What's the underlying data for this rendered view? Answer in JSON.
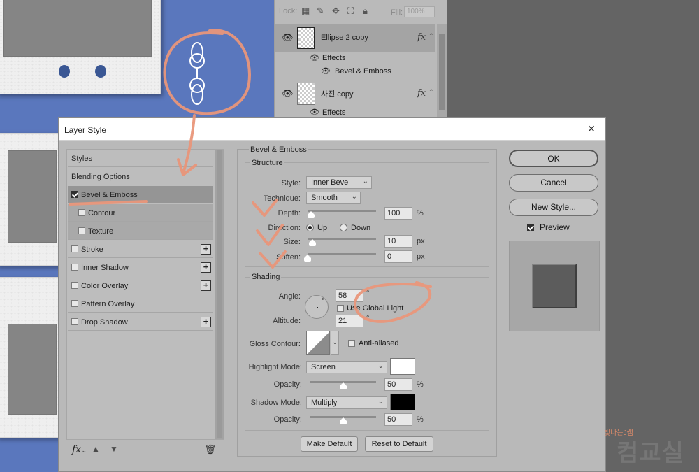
{
  "layers_panel": {
    "lock_label": "Lock:",
    "fill_label": "Fill:",
    "fill_value": "100%",
    "layers": [
      {
        "name": "Ellipse 2 copy",
        "effects_label": "Effects",
        "effect": "Bevel & Emboss"
      },
      {
        "name": "사진 copy",
        "effects_label": "Effects"
      }
    ]
  },
  "dialog": {
    "title": "Layer Style",
    "close_glyph": "×",
    "style_list": [
      {
        "label": "Styles",
        "type": "header"
      },
      {
        "label": "Blending Options",
        "type": "header"
      },
      {
        "label": "Bevel & Emboss",
        "checked": true,
        "selected": true
      },
      {
        "label": "Contour",
        "checked": false,
        "sub": true
      },
      {
        "label": "Texture",
        "checked": false,
        "sub": true
      },
      {
        "label": "Stroke",
        "checked": false,
        "plus": true
      },
      {
        "label": "Inner Shadow",
        "checked": false,
        "plus": true
      },
      {
        "label": "Color Overlay",
        "checked": false,
        "plus": true
      },
      {
        "label": "Pattern Overlay",
        "checked": false
      },
      {
        "label": "Drop Shadow",
        "checked": false,
        "plus": true
      }
    ],
    "footer": {
      "fx": "fx",
      "fx_caret": "⌄",
      "up": "▲",
      "down": "▼",
      "trash": "🗑"
    },
    "section_title": "Bevel & Emboss",
    "structure": {
      "title": "Structure",
      "style_label": "Style:",
      "style_value": "Inner Bevel",
      "technique_label": "Technique:",
      "technique_value": "Smooth",
      "depth_label": "Depth:",
      "depth_value": "100",
      "depth_unit": "%",
      "depth_frac": 0.05,
      "direction_label": "Direction:",
      "dir_up": "Up",
      "dir_down": "Down",
      "size_label": "Size:",
      "size_value": "10",
      "size_unit": "px",
      "size_frac": 0.07,
      "soften_label": "Soften:",
      "soften_value": "0",
      "soften_unit": "px",
      "soften_frac": 0.0
    },
    "shading": {
      "title": "Shading",
      "angle_label": "Angle:",
      "angle_value": "58",
      "angle_unit": "°",
      "use_global_light": "Use Global Light",
      "altitude_label": "Altitude:",
      "altitude_value": "21",
      "altitude_unit": "°",
      "gloss_label": "Gloss Contour:",
      "anti_aliased": "Anti-aliased",
      "highlight_label": "Highlight Mode:",
      "highlight_value": "Screen",
      "highlight_color": "#ffffff",
      "opacity_label": "Opacity:",
      "highlight_opacity": "50",
      "highlight_opacity_frac": 0.5,
      "opacity_unit": "%",
      "shadow_label": "Shadow Mode:",
      "shadow_value": "Multiply",
      "shadow_color": "#000000",
      "shadow_opacity": "50",
      "shadow_opacity_frac": 0.5
    },
    "make_default": "Make Default",
    "reset_default": "Reset to Default",
    "ok": "OK",
    "cancel": "Cancel",
    "new_style": "New Style...",
    "preview_label": "Preview",
    "preview_checked": true
  },
  "watermark": {
    "tag": "빛나는J쌤",
    "text": "컴교실"
  },
  "colors": {
    "canvas_blue": "#5a77bd",
    "annotation": "#e9967a"
  }
}
